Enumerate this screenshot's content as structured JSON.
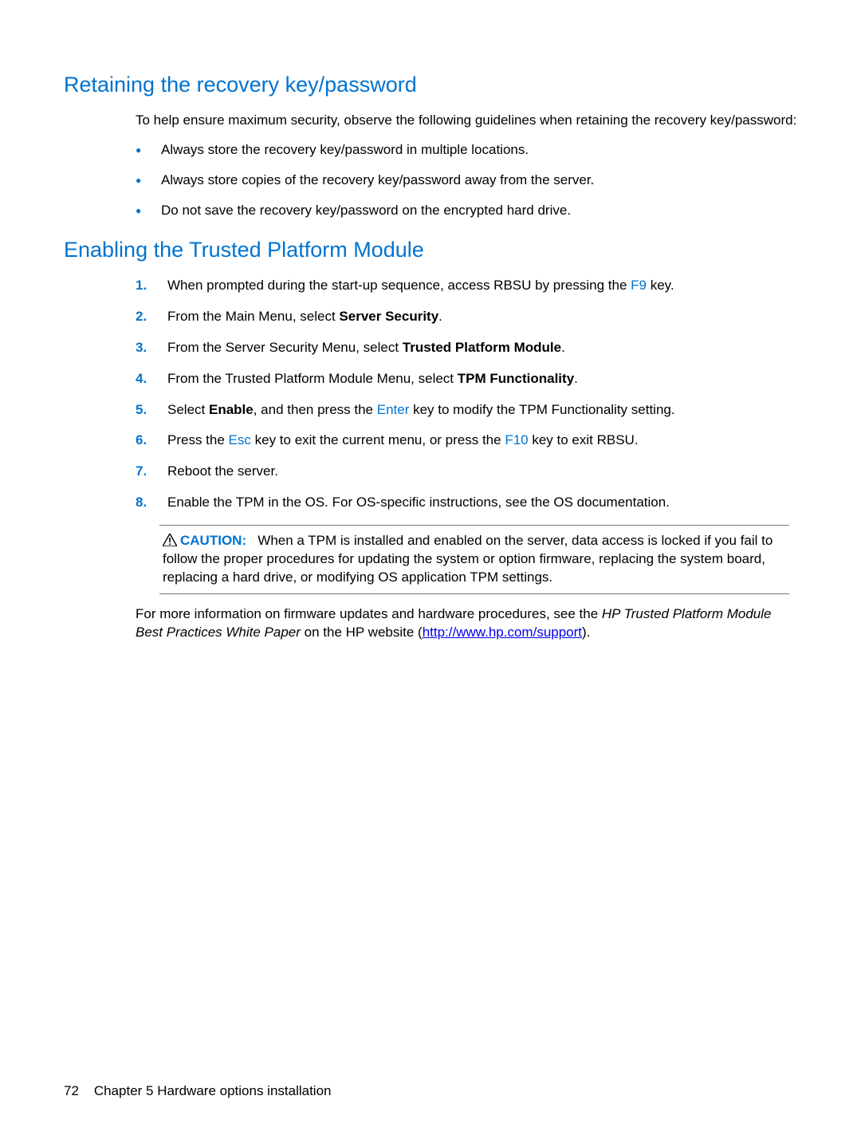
{
  "section1": {
    "title": "Retaining the recovery key/password",
    "intro": "To help ensure maximum security, observe the following guidelines when retaining the recovery key/password:",
    "bullets": [
      "Always store the recovery key/password in multiple locations.",
      "Always store copies of the recovery key/password away from the server.",
      "Do not save the recovery key/password on the encrypted hard drive."
    ]
  },
  "section2": {
    "title": "Enabling the Trusted Platform Module",
    "steps": {
      "s1a": "When prompted during the start-up sequence, access RBSU by pressing the ",
      "s1key": "F9",
      "s1b": " key.",
      "s2a": "From the Main Menu, select ",
      "s2bold": "Server Security",
      "s2b": ".",
      "s3a": "From the Server Security Menu, select ",
      "s3bold": "Trusted Platform Module",
      "s3b": ".",
      "s4a": "From the Trusted Platform Module Menu, select ",
      "s4bold": "TPM Functionality",
      "s4b": ".",
      "s5a": "Select ",
      "s5bold": "Enable",
      "s5b": ", and then press the ",
      "s5key": "Enter",
      "s5c": " key to modify the TPM Functionality setting.",
      "s6a": "Press the ",
      "s6key1": "Esc",
      "s6b": " key to exit the current menu, or press the ",
      "s6key2": "F10",
      "s6c": " key to exit RBSU.",
      "s7": "Reboot the server.",
      "s8": "Enable the TPM in the OS. For OS-specific instructions, see the OS documentation."
    },
    "caution": {
      "label": "CAUTION:",
      "text": "When a TPM is installed and enabled on the server, data access is locked if you fail to follow the proper procedures for updating the system or option firmware, replacing the system board, replacing a hard drive, or modifying OS application TPM settings."
    },
    "moreinfo": {
      "a": "For more information on firmware updates and hardware procedures, see the ",
      "italic": "HP Trusted Platform Module Best Practices White Paper",
      "b": " on the HP website (",
      "link": "http://www.hp.com/support",
      "c": ")."
    }
  },
  "footer": {
    "pagenum": "72",
    "chapter": "Chapter 5   Hardware options installation"
  }
}
